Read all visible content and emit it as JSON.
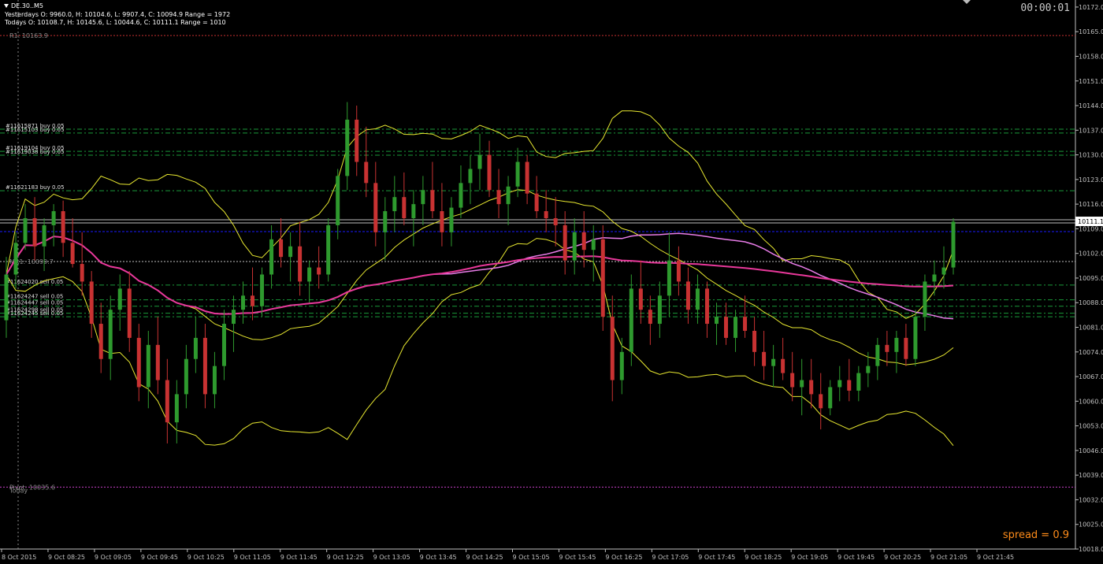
{
  "header": {
    "symbol": "DE.30..M5",
    "yesterday": "Yesterdays O: 9960.0, H: 10104.6, L: 9907.4, C: 10094.9 Range = 1972",
    "today": "Todays O: 10108.7, H: 10145.6, L: 10044.6, C: 10111.1 Range = 1010",
    "timer": "00:00:01"
  },
  "spread_label": "spread = 0.9",
  "colors": {
    "background": "#000000",
    "bull": "#2e9a2e",
    "bear": "#c83232",
    "bollinger": "#e8e830",
    "ma_fast": "#e87ce8",
    "ma_slow": "#e8389a",
    "order_line": "#1a9a3a",
    "r1_line": "#c83232",
    "pivot_line": "#c840c8",
    "blue_line": "#1a1aff",
    "price_line": "#c0c0c0"
  },
  "chart_data": {
    "type": "candlestick",
    "symbol": "DE.30..M5",
    "y_range": [
      10018,
      10174
    ],
    "y_ticks": [
      "10172.0",
      "10165.0",
      "10158.0",
      "10151.0",
      "10144.0",
      "10137.0",
      "10130.0",
      "10123.0",
      "10116.0",
      "10109.0",
      "10102.0",
      "10095.0",
      "10088.0",
      "10081.0",
      "10074.0",
      "10067.0",
      "10060.0",
      "10053.0",
      "10046.0",
      "10039.0",
      "10032.0",
      "10025.0",
      "10018.0"
    ],
    "x_ticks": [
      "8 Oct 2015",
      "9 Oct 08:25",
      "9 Oct 09:05",
      "9 Oct 09:45",
      "9 Oct 10:25",
      "9 Oct 11:05",
      "9 Oct 11:45",
      "9 Oct 12:25",
      "9 Oct 13:05",
      "9 Oct 13:45",
      "9 Oct 14:25",
      "9 Oct 15:05",
      "9 Oct 15:45",
      "9 Oct 16:25",
      "9 Oct 17:05",
      "9 Oct 17:45",
      "9 Oct 18:25",
      "9 Oct 19:05",
      "9 Oct 19:45",
      "9 Oct 20:25",
      "9 Oct 21:05",
      "9 Oct 21:45"
    ],
    "current_price": "10111.1",
    "levels": [
      {
        "label": "R1: 10163.9",
        "price": 10163.9,
        "kind": "r1"
      },
      {
        "label": "MR1: 10099.7",
        "price": 10099.7,
        "kind": "mid"
      },
      {
        "label": "Pivot: 10035.6",
        "price": 10035.6,
        "kind": "pivot"
      }
    ],
    "extra_labels": [
      "Today"
    ],
    "blue_level": 10108.2,
    "orders": [
      {
        "label": "#11615871 buy 0.05",
        "price": 10137.3
      },
      {
        "label": "#11615103 buy 0.05",
        "price": 10136.2
      },
      {
        "label": "#11619104 buy 0.05",
        "price": 10131.0
      },
      {
        "label": "#11619038 buy 0.05",
        "price": 10129.9
      },
      {
        "label": "#11621183 buy 0.05",
        "price": 10119.8
      },
      {
        "label": "#11624020 sell 0.05",
        "price": 10093.0
      },
      {
        "label": "#11624247 sell 0.05",
        "price": 10088.8
      },
      {
        "label": "#11624447 sell 0.05",
        "price": 10087.0
      },
      {
        "label": "#11624298 sell 0.05",
        "price": 10085.0
      },
      {
        "label": "#11624245 sell 0.05",
        "price": 10084.0
      }
    ],
    "candles": [
      [
        10083,
        10101,
        10078,
        10096
      ],
      [
        10096,
        10108,
        10092,
        10105
      ],
      [
        10105,
        10116,
        10103,
        10112
      ],
      [
        10112,
        10118,
        10100,
        10104
      ],
      [
        10104,
        10112,
        10097,
        10110
      ],
      [
        10110,
        10116,
        10104,
        10114
      ],
      [
        10114,
        10117,
        10101,
        10105
      ],
      [
        10105,
        10112,
        10098,
        10099
      ],
      [
        10099,
        10108,
        10090,
        10094
      ],
      [
        10094,
        10097,
        10078,
        10082
      ],
      [
        10082,
        10088,
        10068,
        10072
      ],
      [
        10072,
        10090,
        10066,
        10086
      ],
      [
        10086,
        10096,
        10080,
        10092
      ],
      [
        10092,
        10097,
        10074,
        10078
      ],
      [
        10078,
        10082,
        10060,
        10064
      ],
      [
        10064,
        10080,
        10058,
        10076
      ],
      [
        10076,
        10084,
        10062,
        10066
      ],
      [
        10066,
        10072,
        10048,
        10054
      ],
      [
        10054,
        10066,
        10048,
        10062
      ],
      [
        10062,
        10076,
        10058,
        10072
      ],
      [
        10072,
        10084,
        10068,
        10078
      ],
      [
        10078,
        10082,
        10058,
        10062
      ],
      [
        10062,
        10074,
        10058,
        10070
      ],
      [
        10070,
        10086,
        10066,
        10082
      ],
      [
        10082,
        10090,
        10074,
        10086
      ],
      [
        10086,
        10094,
        10082,
        10090
      ],
      [
        10090,
        10098,
        10083,
        10087
      ],
      [
        10087,
        10098,
        10084,
        10096
      ],
      [
        10096,
        10110,
        10092,
        10106
      ],
      [
        10106,
        10112,
        10098,
        10101
      ],
      [
        10101,
        10108,
        10094,
        10104
      ],
      [
        10104,
        10111,
        10090,
        10094
      ],
      [
        10094,
        10100,
        10088,
        10098
      ],
      [
        10098,
        10104,
        10092,
        10096
      ],
      [
        10096,
        10112,
        10094,
        10110
      ],
      [
        10110,
        10126,
        10106,
        10124
      ],
      [
        10124,
        10145,
        10120,
        10140
      ],
      [
        10140,
        10144,
        10124,
        10128
      ],
      [
        10128,
        10138,
        10118,
        10122
      ],
      [
        10122,
        10128,
        10104,
        10108
      ],
      [
        10108,
        10118,
        10100,
        10114
      ],
      [
        10114,
        10124,
        10108,
        10118
      ],
      [
        10118,
        10125,
        10110,
        10112
      ],
      [
        10112,
        10120,
        10104,
        10116
      ],
      [
        10116,
        10124,
        10110,
        10120
      ],
      [
        10120,
        10128,
        10112,
        10114
      ],
      [
        10114,
        10122,
        10104,
        10108
      ],
      [
        10108,
        10118,
        10104,
        10115
      ],
      [
        10115,
        10127,
        10112,
        10122
      ],
      [
        10122,
        10130,
        10116,
        10126
      ],
      [
        10126,
        10136,
        10120,
        10130
      ],
      [
        10130,
        10134,
        10118,
        10120
      ],
      [
        10120,
        10126,
        10112,
        10116
      ],
      [
        10116,
        10124,
        10110,
        10121
      ],
      [
        10121,
        10132,
        10118,
        10128
      ],
      [
        10128,
        10130,
        10116,
        10119
      ],
      [
        10119,
        10124,
        10112,
        10114
      ],
      [
        10114,
        10120,
        10108,
        10112
      ],
      [
        10112,
        10118,
        10104,
        10110
      ],
      [
        10110,
        10114,
        10096,
        10100
      ],
      [
        10100,
        10112,
        10096,
        10108
      ],
      [
        10108,
        10114,
        10098,
        10103
      ],
      [
        10103,
        10110,
        10094,
        10106
      ],
      [
        10106,
        10110,
        10080,
        10084
      ],
      [
        10084,
        10090,
        10060,
        10066
      ],
      [
        10066,
        10078,
        10062,
        10074
      ],
      [
        10074,
        10096,
        10070,
        10092
      ],
      [
        10092,
        10100,
        10082,
        10086
      ],
      [
        10086,
        10090,
        10076,
        10082
      ],
      [
        10082,
        10094,
        10078,
        10090
      ],
      [
        10090,
        10108,
        10084,
        10100
      ],
      [
        10100,
        10104,
        10090,
        10094
      ],
      [
        10094,
        10098,
        10082,
        10086
      ],
      [
        10086,
        10096,
        10082,
        10092
      ],
      [
        10092,
        10094,
        10078,
        10082
      ],
      [
        10082,
        10088,
        10076,
        10084
      ],
      [
        10084,
        10088,
        10076,
        10078
      ],
      [
        10078,
        10086,
        10074,
        10084
      ],
      [
        10084,
        10090,
        10078,
        10080
      ],
      [
        10080,
        10084,
        10070,
        10074
      ],
      [
        10074,
        10080,
        10066,
        10070
      ],
      [
        10070,
        10076,
        10064,
        10072
      ],
      [
        10072,
        10078,
        10066,
        10068
      ],
      [
        10068,
        10074,
        10060,
        10064
      ],
      [
        10064,
        10072,
        10056,
        10066
      ],
      [
        10066,
        10072,
        10058,
        10062
      ],
      [
        10062,
        10068,
        10052,
        10058
      ],
      [
        10058,
        10066,
        10056,
        10064
      ],
      [
        10064,
        10070,
        10060,
        10066
      ],
      [
        10066,
        10072,
        10060,
        10063
      ],
      [
        10063,
        10070,
        10060,
        10068
      ],
      [
        10068,
        10074,
        10064,
        10070
      ],
      [
        10070,
        10078,
        10066,
        10076
      ],
      [
        10076,
        10080,
        10070,
        10074
      ],
      [
        10074,
        10080,
        10068,
        10078
      ],
      [
        10078,
        10082,
        10070,
        10072
      ],
      [
        10072,
        10086,
        10070,
        10084
      ],
      [
        10084,
        10096,
        10080,
        10094
      ],
      [
        10094,
        10100,
        10090,
        10096
      ],
      [
        10096,
        10104,
        10092,
        10098
      ],
      [
        10098,
        10112,
        10096,
        10111
      ]
    ]
  }
}
